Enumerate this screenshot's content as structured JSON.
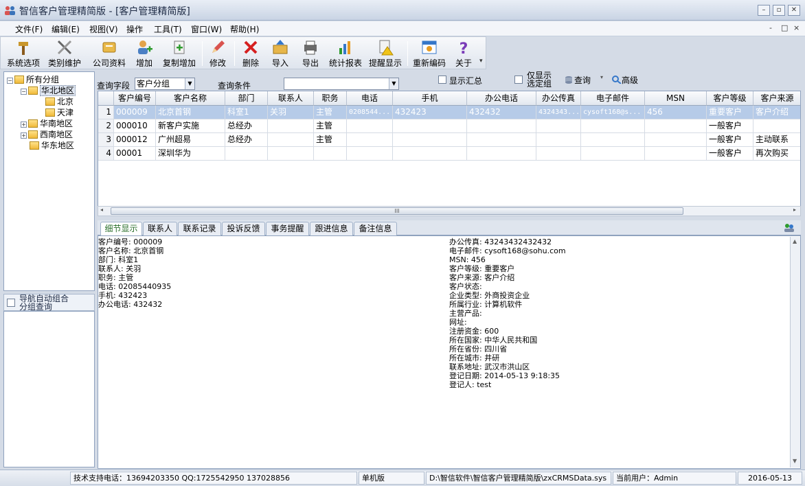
{
  "window": {
    "title": "智信客户管理精简版 - [客户管理精简版]",
    "controls": [
      "minimize",
      "restore",
      "close"
    ]
  },
  "menu": {
    "items": [
      "文件(F)",
      "编辑(E)",
      "视图(V)",
      "操作",
      "工具(T)",
      "窗口(W)",
      "帮助(H)"
    ],
    "mdi_controls": [
      "-",
      "□",
      "×"
    ]
  },
  "toolbar": {
    "buttons": [
      {
        "label": "系统选项",
        "icon": "hammer-icon"
      },
      {
        "label": "类别维护",
        "icon": "tools-icon"
      },
      {
        "label": "公司资料",
        "icon": "company-icon"
      },
      {
        "label": "增加",
        "icon": "add-user-icon"
      },
      {
        "label": "复制增加",
        "icon": "copy-add-icon"
      },
      {
        "label": "修改",
        "icon": "pencil-icon"
      },
      {
        "label": "删除",
        "icon": "delete-x-icon"
      },
      {
        "label": "导入",
        "icon": "import-icon"
      },
      {
        "label": "导出",
        "icon": "export-icon"
      },
      {
        "label": "统计报表",
        "icon": "chart-icon"
      },
      {
        "label": "提醒显示",
        "icon": "reminder-icon"
      },
      {
        "label": "重新编码",
        "icon": "recode-icon"
      },
      {
        "label": "关于",
        "icon": "help-icon"
      }
    ]
  },
  "tree": {
    "root": "所有分组",
    "nodes": [
      {
        "label": "华北地区",
        "level": 1,
        "expanded": true,
        "selected": true
      },
      {
        "label": "北京",
        "level": 2
      },
      {
        "label": "天津",
        "level": 2
      },
      {
        "label": "华南地区",
        "level": 1,
        "expanded": false
      },
      {
        "label": "西南地区",
        "level": 1,
        "expanded": false
      },
      {
        "label": "华东地区",
        "level": 1
      }
    ]
  },
  "nav": {
    "label_line1": "导航自动组合",
    "label_line2": "分组查询"
  },
  "query": {
    "field_label": "查询字段",
    "field_value": "客户分组",
    "cond_label": "查询条件",
    "cond_value": "",
    "show_summary": "显示汇总",
    "only_selected_line1": "仅显示",
    "only_selected_line2": "选定组",
    "query_btn": "查询",
    "advanced_btn": "高级"
  },
  "grid": {
    "columns": [
      "",
      "客户编号",
      "客户名称",
      "部门",
      "联系人",
      "职务",
      "电话",
      "手机",
      "办公电话",
      "办公传真",
      "电子邮件",
      "MSN",
      "客户等级",
      "客户来源"
    ],
    "rows": [
      [
        "1",
        "000009",
        "北京首钢",
        "科室1",
        "关羽",
        "主管",
        "0208544...",
        "432423",
        "432432",
        "4324343...",
        "cysoft168@s...",
        "456",
        "重要客户",
        "客户介绍"
      ],
      [
        "2",
        "000010",
        "新客户实施",
        "总经办",
        "",
        "主管",
        "",
        "",
        "",
        "",
        "",
        "",
        "一般客户",
        ""
      ],
      [
        "3",
        "000012",
        "广州超易",
        "总经办",
        "",
        "主管",
        "",
        "",
        "",
        "",
        "",
        "",
        "一般客户",
        "主动联系"
      ],
      [
        "4",
        "00001",
        "深圳华为",
        "",
        "",
        "",
        "",
        "",
        "",
        "",
        "",
        "",
        "一般客户",
        "再次购买"
      ]
    ]
  },
  "tabs": [
    "细节显示",
    "联系人",
    "联系记录",
    "投诉反馈",
    "事务提醒",
    "跟进信息",
    "备注信息"
  ],
  "detail": {
    "left": [
      "客户编号: 000009",
      "客户名称: 北京首钢",
      "部门: 科室1",
      "联系人: 关羽",
      "职务: 主管",
      "电话: 02085440935",
      "手机: 432423",
      "办公电话: 432432"
    ],
    "right": [
      "办公传真: 43243432432432",
      "电子邮件: cysoft168@sohu.com",
      "MSN: 456",
      "客户等级: 重要客户",
      "客户来源: 客户介绍",
      "客户状态:",
      "企业类型: 外商投资企业",
      "所属行业: 计算机软件",
      "主营产品:",
      "网址:",
      "注册资金: 600",
      "所在国家: 中华人民共和国",
      "所在省份: 四川省",
      "所在城市: 井研",
      "联系地址: 武汉市洪山区",
      "登记日期: 2014-05-13 9:18:35",
      "登记人: test"
    ]
  },
  "status": {
    "support": "技术支持电话：13694203350 QQ:1725542950 137028856",
    "edition": "单机版",
    "path": "D:\\智信软件\\智信客户管理精简版\\zxCRMSData.sys",
    "user": "当前用户：Admin",
    "date": "2016-05-13"
  }
}
